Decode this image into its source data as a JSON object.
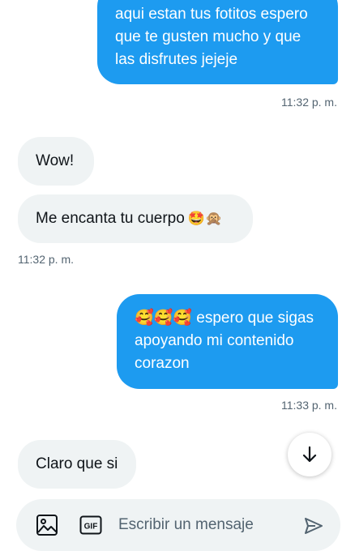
{
  "colors": {
    "outgoing_bubble": "#1d9bf0",
    "incoming_bubble": "#eff3f4",
    "timestamp": "#536471"
  },
  "messages": [
    {
      "direction": "outgoing",
      "text": "aqui estan tus fotitos espero\nque te gusten mucho y que\nlas disfrutes jejeje"
    },
    {
      "direction": "timestamp",
      "text": "11:32 p. m."
    },
    {
      "direction": "incoming",
      "text": "Wow!"
    },
    {
      "direction": "incoming",
      "text": "Me encanta tu cuerpo",
      "emoji": "🤩🙊"
    },
    {
      "direction": "timestamp",
      "text": "11:32 p. m."
    },
    {
      "direction": "outgoing",
      "text": "🥰🥰🥰 espero que sigas\napoyando mi contenido\ncorazon"
    },
    {
      "direction": "timestamp",
      "text": "11:33 p. m."
    },
    {
      "direction": "incoming",
      "text": "Claro que si"
    }
  ],
  "scroll_button": {
    "icon": "arrow-down-icon"
  },
  "composer": {
    "placeholder": "Escribir un mensaje",
    "media_icon": "image-icon",
    "gif_label": "GIF",
    "send_icon": "send-icon"
  }
}
